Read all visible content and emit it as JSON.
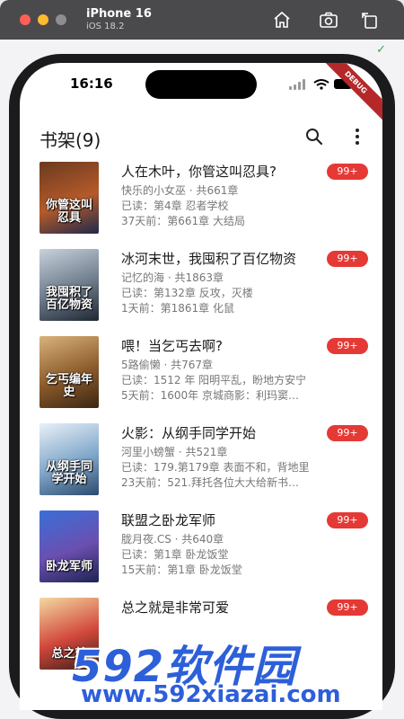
{
  "simulator": {
    "device": "iPhone 16",
    "os": "iOS 18.2"
  },
  "status_bar": {
    "time": "16:16",
    "debug_banner": "DEBUG"
  },
  "appbar": {
    "title": "书架(9)"
  },
  "books": [
    {
      "title": "人在木叶，你管这叫忍具?",
      "author_chapters": "快乐的小女巫 · 共661章",
      "read": "已读：第4章 忍者学校",
      "latest": "37天前：第661章 大结局",
      "badge": "99+",
      "cover_text": "你管这叫忍具",
      "cover_colors": [
        "#6b3a1f",
        "#b45a2a",
        "#1e2a4a"
      ]
    },
    {
      "title": "冰河末世，我囤积了百亿物资",
      "author_chapters": "记忆的海 · 共1863章",
      "read": "已读：第132章 反攻，灭楼",
      "latest": "1天前：第1861章 化鼠",
      "badge": "99+",
      "cover_text": "我囤积了百亿物资",
      "cover_colors": [
        "#c8d2dc",
        "#6c7a8a",
        "#1f2733"
      ]
    },
    {
      "title": "喂！当乞丐去啊?",
      "author_chapters": "5路偷懒 · 共767章",
      "read": "已读：1512 年 阳明平乱，盼地方安宁",
      "latest": "5天前：1600年 京城商影：利玛窦…",
      "badge": "99+",
      "cover_text": "乞丐编年史",
      "cover_colors": [
        "#d9b27a",
        "#8a5a2b",
        "#3b2612"
      ]
    },
    {
      "title": "火影：从纲手同学开始",
      "author_chapters": "河里小螃蟹 · 共521章",
      "read": "已读：179.第179章 表面不和，背地里",
      "latest": "23天前：521.拜托各位大大给新书…",
      "badge": "99+",
      "cover_text": "从纲手同学开始",
      "cover_colors": [
        "#e8f0f8",
        "#7fa6c9",
        "#2c4a6e"
      ]
    },
    {
      "title": "联盟之卧龙军师",
      "author_chapters": "胧月夜.CS · 共640章",
      "read": "已读：第1章 卧龙饭堂",
      "latest": "15天前：第1章 卧龙饭堂",
      "badge": "99+",
      "cover_text": "卧龙军师",
      "cover_colors": [
        "#3a6fd8",
        "#6a4fb0",
        "#1e2452"
      ]
    },
    {
      "title": "总之就是非常可爱",
      "author_chapters": "",
      "read": "",
      "latest": "",
      "badge": "99+",
      "cover_text": "总之就",
      "cover_colors": [
        "#f3d9a0",
        "#d2473b",
        "#3a1f1a"
      ]
    }
  ],
  "watermark": {
    "logo": "592软件园",
    "url": "www.592xiazai.com"
  },
  "colors": {
    "badge": "#e53935",
    "accent": "#2d5fd9"
  }
}
